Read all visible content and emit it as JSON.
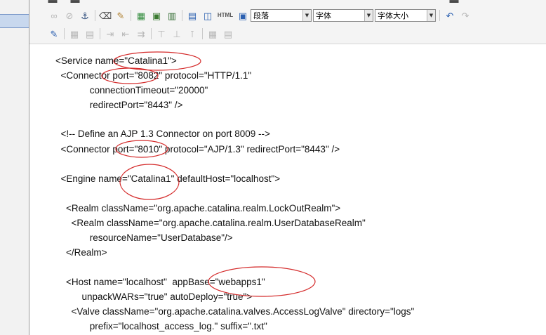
{
  "toolbar": {
    "format_combo": "段落",
    "font_combo": "字体",
    "size_combo": "字体大小",
    "html_label": "HTML"
  },
  "code_lines": [
    "<Service name=\"Catalina1\">",
    "  <Connector port=\"8082\" protocol=\"HTTP/1.1\"",
    "             connectionTimeout=\"20000\"",
    "             redirectPort=\"8443\" />",
    "  <!-- Define an AJP 1.3 Connector on port 8009 -->",
    "  <Connector port=\"8010\" protocol=\"AJP/1.3\" redirectPort=\"8443\" />",
    "  <Engine name=\"Catalina1\" defaultHost=\"localhost\">",
    "    <Realm className=\"org.apache.catalina.realm.LockOutRealm\">",
    "      <Realm className=\"org.apache.catalina.realm.UserDatabaseRealm\"",
    "             resourceName=\"UserDatabase\"/>",
    "    </Realm>",
    "    <Host name=\"localhost\"  appBase=\"webapps1\"",
    "          unpackWARs=\"true\" autoDeploy=\"true\">",
    "      <Valve className=\"org.apache.catalina.valves.AccessLogValve\" directory=\"logs\"",
    "             prefix=\"localhost_access_log.\" suffix=\".txt\""
  ],
  "annotation_color": "#d42a2a"
}
